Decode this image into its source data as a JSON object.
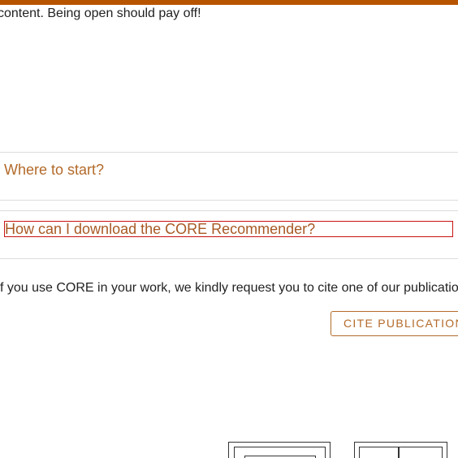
{
  "intro": {
    "text": "content. Being open should pay off!"
  },
  "faq": {
    "items": [
      {
        "label": "Where to start?"
      },
      {
        "label": "How can I download the CORE Recommender?"
      }
    ]
  },
  "cite": {
    "text": "f you use CORE in your work, we kindly request you to cite one of our publications",
    "button_label": "CITE PUBLICATION"
  },
  "colors": {
    "accent": "#b75400",
    "link": "#b36a2a",
    "focus_outline": "#c81414"
  }
}
